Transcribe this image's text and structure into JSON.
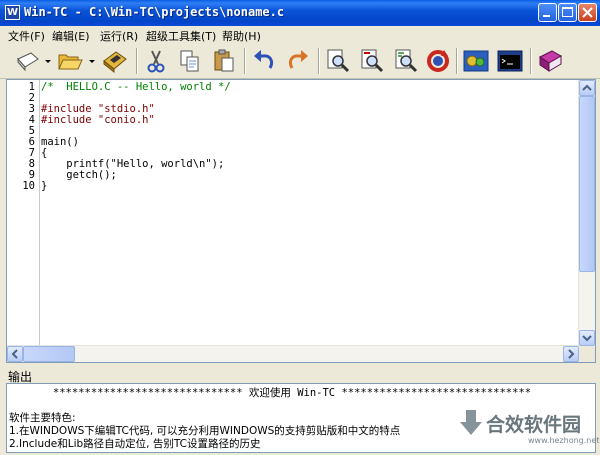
{
  "window": {
    "title": "Win-TC - C:\\Win-TC\\projects\\noname.c",
    "app_icon_letter": "W"
  },
  "menu": {
    "items": [
      {
        "label": "文件(F)"
      },
      {
        "label": "编辑(E)"
      },
      {
        "label": "运行(R)"
      },
      {
        "label": "超级工具集(T)"
      },
      {
        "label": "帮助(H)"
      }
    ]
  },
  "toolbar": {
    "buttons": [
      "new-file",
      "open-folder",
      "save",
      "cut",
      "copy",
      "paste",
      "undo",
      "redo",
      "find",
      "find-next",
      "replace",
      "refresh",
      "compile-run",
      "console",
      "help-book"
    ]
  },
  "editor": {
    "lines": [
      {
        "num": "1",
        "text": "/*  HELLO.C -- Hello, world */"
      },
      {
        "num": "2",
        "text": ""
      },
      {
        "num": "3",
        "text": "#include \"stdio.h\""
      },
      {
        "num": "4",
        "text": "#include \"conio.h\""
      },
      {
        "num": "5",
        "text": ""
      },
      {
        "num": "6",
        "text": "main()"
      },
      {
        "num": "7",
        "text": "{"
      },
      {
        "num": "8",
        "text": "    printf(\"Hello, world\\n\");"
      },
      {
        "num": "9",
        "text": "    getch();"
      },
      {
        "num": "10",
        "text": "}"
      }
    ],
    "colors": {
      "comment": "#008000",
      "preprocessor": "#800000",
      "text": "#000000"
    }
  },
  "output": {
    "label": "输出",
    "banner": "****************************** 欢迎使用 Win-TC ******************************",
    "features_heading": "软件主要特色:",
    "feature_1": "1.在WINDOWS下编辑TC代码, 可以充分利用WINDOWS的支持剪贴版和中文的特点",
    "feature_2": "2.Include和Lib路径自动定位, 告别TC设置路径的历史"
  },
  "watermark": {
    "text": "合效软件园",
    "url": "www.hezhong.net"
  }
}
